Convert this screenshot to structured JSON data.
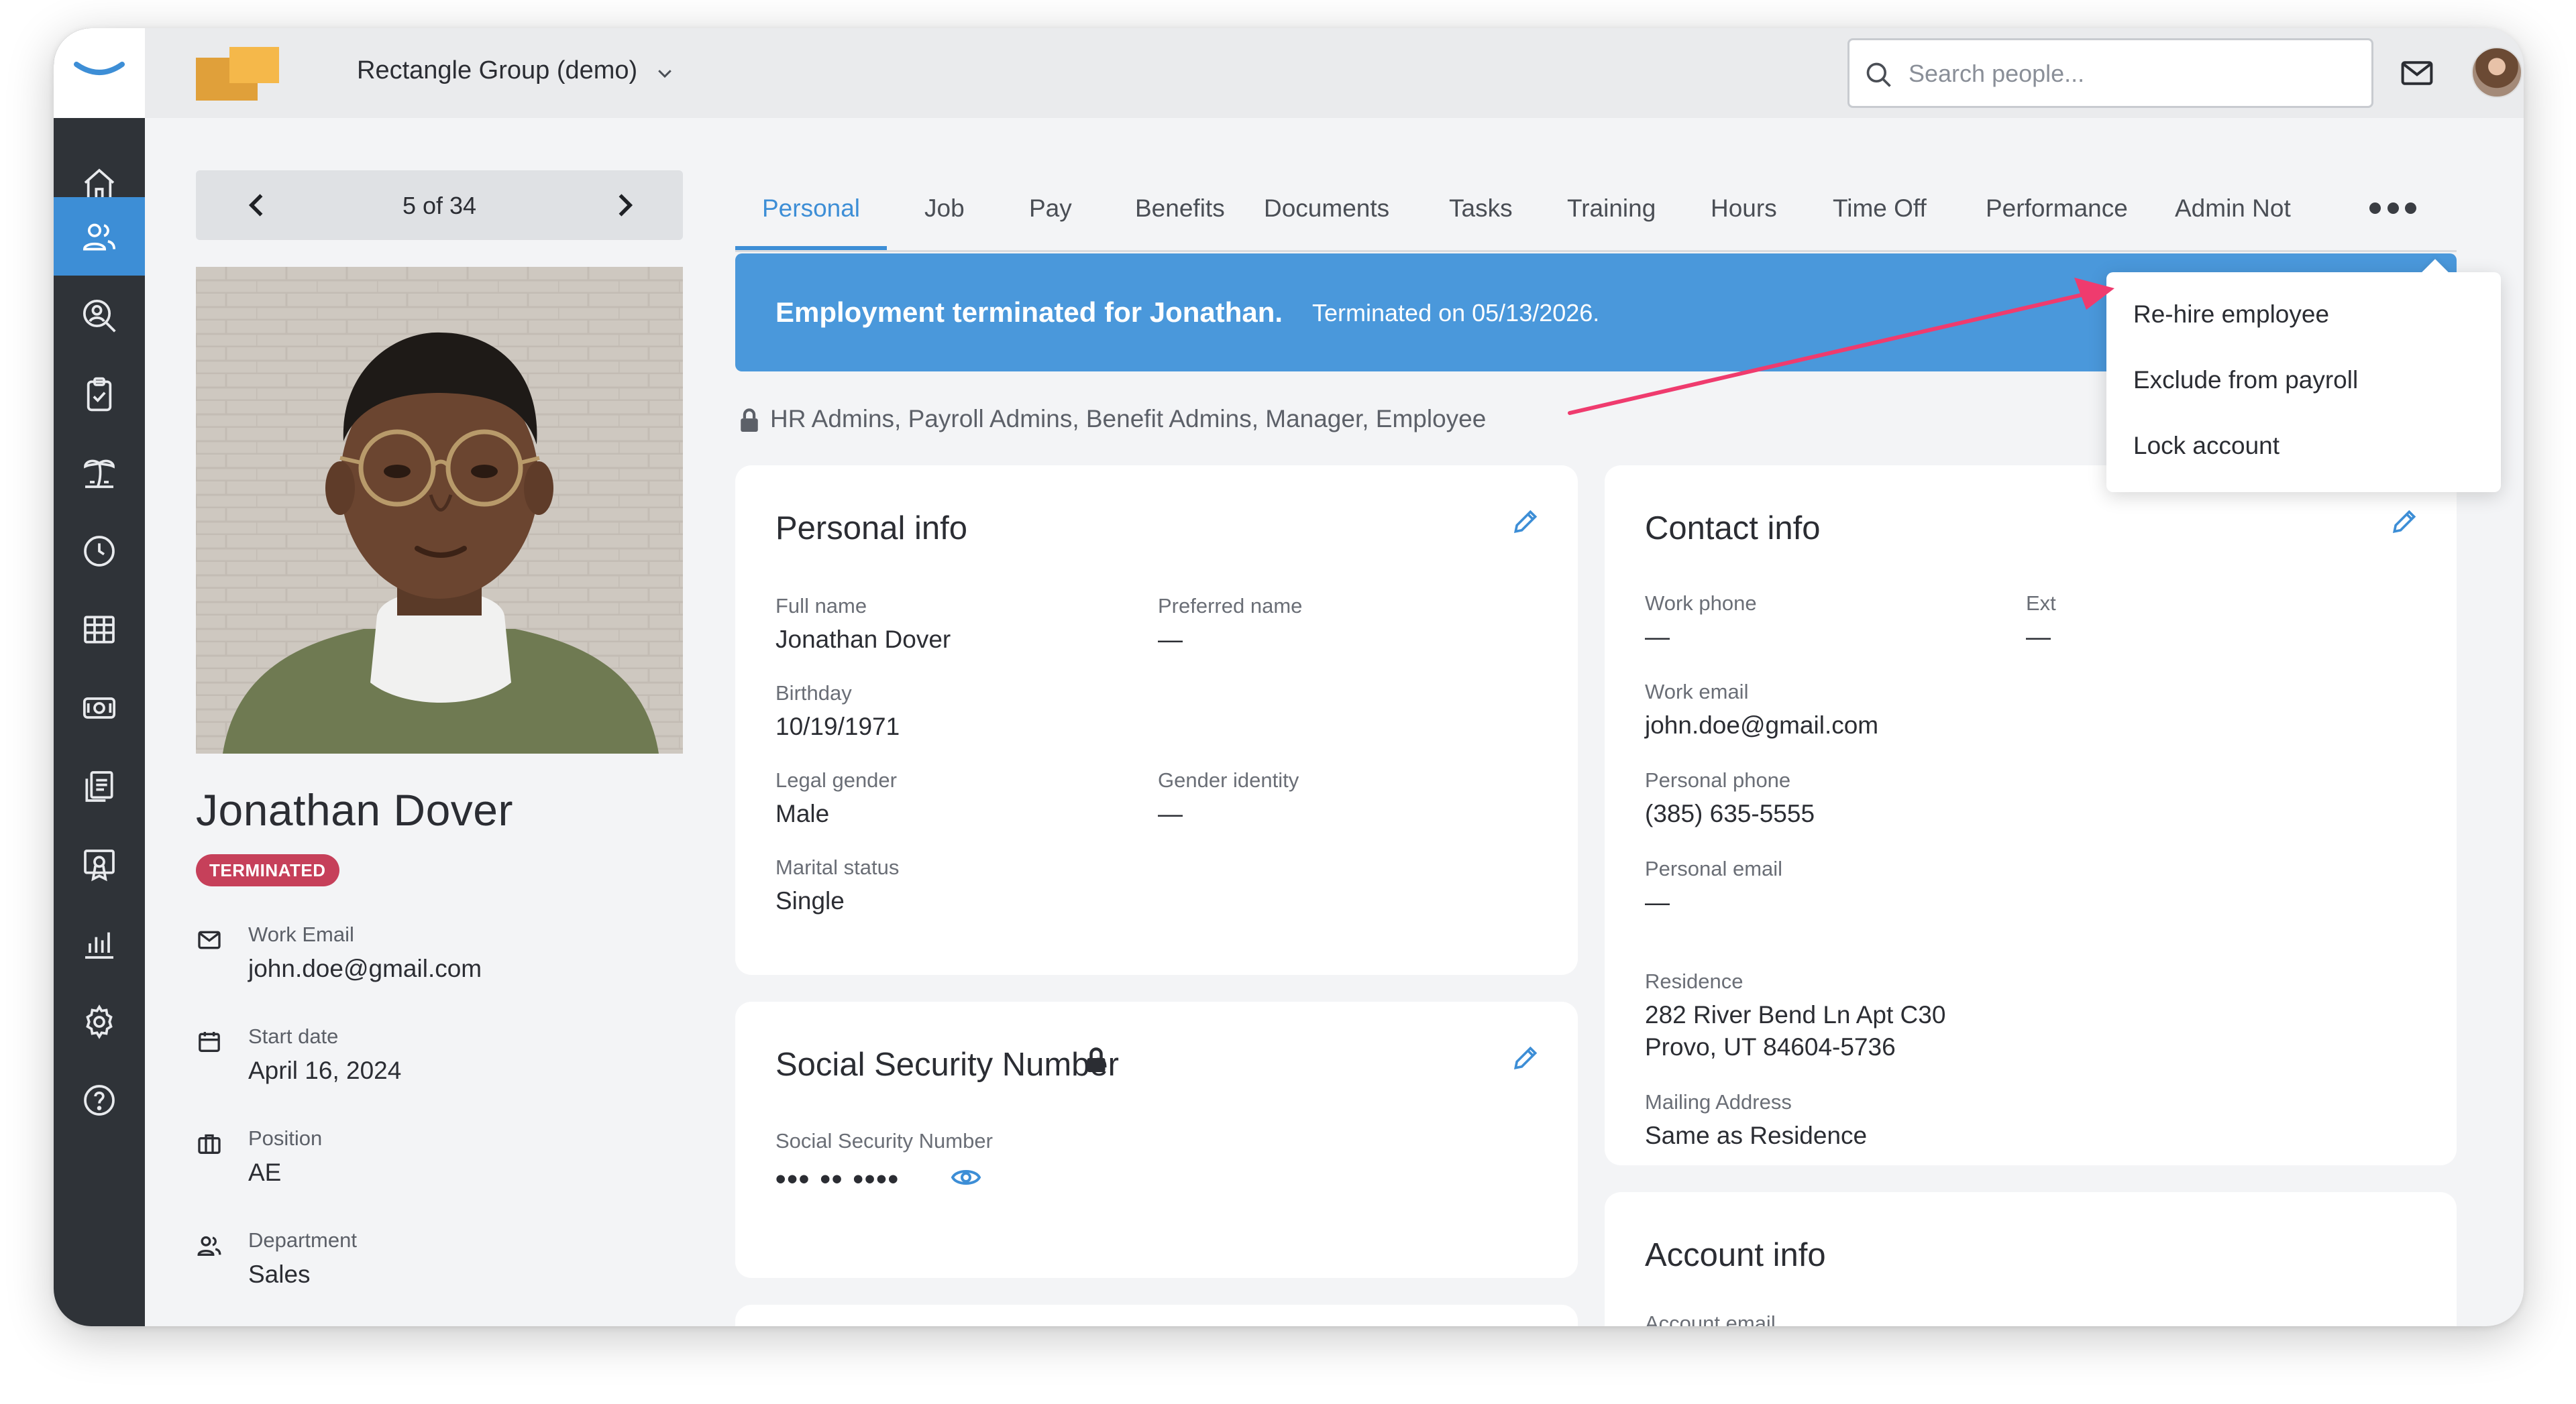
{
  "company": {
    "name": "Rectangle Group (demo)"
  },
  "search": {
    "placeholder": "Search people..."
  },
  "sidebar": {
    "items": [
      {
        "icon": "home-icon"
      },
      {
        "icon": "people-icon",
        "active": true
      },
      {
        "icon": "people-search-icon"
      },
      {
        "icon": "clipboard-check-icon"
      },
      {
        "icon": "beach-icon"
      },
      {
        "icon": "clock-icon"
      },
      {
        "icon": "table-icon"
      },
      {
        "icon": "money-icon"
      },
      {
        "icon": "documents-icon"
      },
      {
        "icon": "certificate-icon"
      },
      {
        "icon": "bar-chart-icon"
      },
      {
        "icon": "gear-icon"
      },
      {
        "icon": "help-icon"
      }
    ]
  },
  "pager": {
    "label": "5 of 34"
  },
  "employee": {
    "name": "Jonathan Dover",
    "status": "TERMINATED",
    "details": [
      {
        "icon": "mail-icon",
        "label": "Work Email",
        "value": "john.doe@gmail.com"
      },
      {
        "icon": "calendar-icon",
        "label": "Start date",
        "value": "April 16, 2024"
      },
      {
        "icon": "briefcase-icon",
        "label": "Position",
        "value": "AE"
      },
      {
        "icon": "people-icon",
        "label": "Department",
        "value": "Sales"
      }
    ]
  },
  "tabs": [
    {
      "label": "Personal",
      "active": true
    },
    {
      "label": "Job"
    },
    {
      "label": "Pay"
    },
    {
      "label": "Benefits"
    },
    {
      "label": "Documents"
    },
    {
      "label": "Tasks"
    },
    {
      "label": "Training"
    },
    {
      "label": "Hours"
    },
    {
      "label": "Time Off"
    },
    {
      "label": "Performance"
    },
    {
      "label": "Admin Not"
    }
  ],
  "banner": {
    "title": "Employment terminated for Jonathan.",
    "subtitle": "Terminated on 05/13/2026."
  },
  "access": {
    "text": "HR Admins, Payroll Admins, Benefit Admins, Manager, Employee"
  },
  "more_menu": {
    "items": [
      "Re-hire employee",
      "Exclude from payroll",
      "Lock account"
    ]
  },
  "personal_info": {
    "title": "Personal info",
    "fields": {
      "full_name": {
        "label": "Full name",
        "value": "Jonathan Dover"
      },
      "preferred_name": {
        "label": "Preferred name",
        "value": "—"
      },
      "birthday": {
        "label": "Birthday",
        "value": "10/19/1971"
      },
      "legal_gender": {
        "label": "Legal gender",
        "value": "Male"
      },
      "gender_identity": {
        "label": "Gender identity",
        "value": "—"
      },
      "marital_status": {
        "label": "Marital status",
        "value": "Single"
      }
    }
  },
  "ssn": {
    "title": "Social Security Number",
    "label": "Social Security Number",
    "masked": "••• •• ••••"
  },
  "contact_info": {
    "title": "Contact info",
    "fields": {
      "work_phone": {
        "label": "Work phone",
        "value": "—"
      },
      "ext": {
        "label": "Ext",
        "value": "—"
      },
      "work_email": {
        "label": "Work email",
        "value": "john.doe@gmail.com"
      },
      "personal_phone": {
        "label": "Personal phone",
        "value": "(385) 635-5555"
      },
      "personal_email": {
        "label": "Personal email",
        "value": "—"
      },
      "residence": {
        "label": "Residence",
        "line1": "282 River Bend Ln Apt C30",
        "line2": "Provo, UT 84604-5736"
      },
      "mailing_address": {
        "label": "Mailing Address",
        "value": "Same as Residence"
      }
    }
  },
  "account_info": {
    "title": "Account info",
    "partial_label": "Account email"
  },
  "colors": {
    "accent": "#3d8ed6",
    "banner": "#4a98db",
    "terminated": "#c6405a",
    "sidebar": "#2f3338",
    "arrow": "#ef3b6e"
  }
}
